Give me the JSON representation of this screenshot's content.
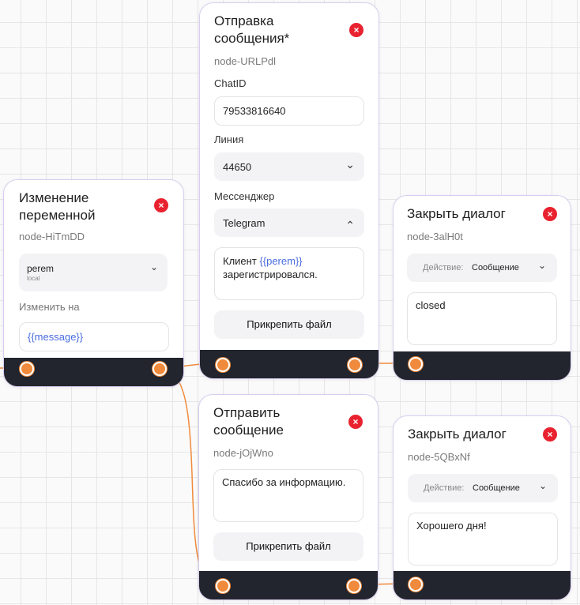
{
  "colors": {
    "accent": "#f08a3c",
    "close": "#e8222e",
    "footer": "#22252d",
    "variable": "#4a6de0"
  },
  "nodes": {
    "change_var": {
      "title": "Изменение переменной",
      "id": "node-HiTmDD",
      "select_value": "perem",
      "select_sub": "local",
      "change_label": "Изменить на",
      "change_value": "{{message}}"
    },
    "send_msg1": {
      "title": "Отправка сообщения*",
      "id": "node-URLPdl",
      "chat_label": "ChatID",
      "chat_value": "79533816640",
      "line_label": "Линия",
      "line_value": "44650",
      "messenger_label": "Мессенджер",
      "messenger_value": "Telegram",
      "msg_prefix": "Клиент ",
      "msg_var": "{{perem}}",
      "msg_suffix": " зарегистрировался.",
      "attach_label": "Прикрепить файл"
    },
    "close1": {
      "title": "Закрыть диалог",
      "id": "node-3alH0t",
      "action_label": "Действие:",
      "action_value": "Сообщение",
      "text": "closed"
    },
    "send_msg2": {
      "title": "Отправить сообщение",
      "id": "node-jOjWno",
      "text": "Спасибо за информацию.",
      "attach_label": "Прикрепить файл"
    },
    "close2": {
      "title": "Закрыть диалог",
      "id": "node-5QBxNf",
      "action_label": "Действие:",
      "action_value": "Сообщение",
      "text": "Хорошего дня!"
    }
  },
  "icons": {
    "close": "×",
    "chevron_down": "⌄",
    "chevron_up": "⌃"
  }
}
